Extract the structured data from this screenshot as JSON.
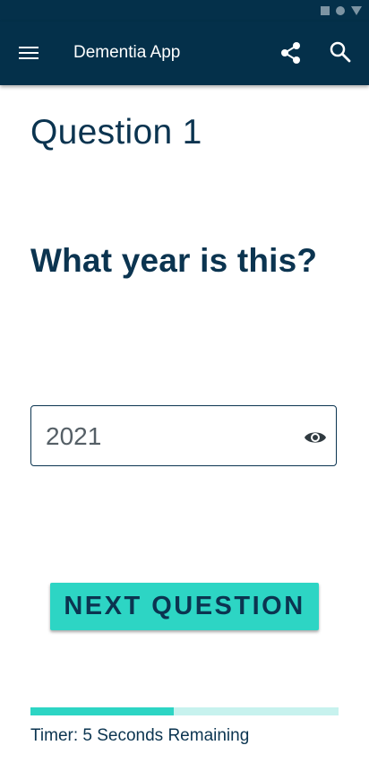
{
  "app_bar": {
    "title": "Dementia App",
    "menu_icon": "hamburger-menu-icon",
    "share_icon": "share-icon",
    "search_icon": "search-icon"
  },
  "question": {
    "number_label": "Question 1",
    "text": "What year is this?"
  },
  "answer": {
    "value": "2021",
    "visibility_icon": "eye-icon"
  },
  "next_button_label": "NEXT QUESTION",
  "timer": {
    "label": "Timer: 5 Seconds Remaining",
    "progress_fraction": 0.465
  },
  "colors": {
    "app_bar": "#04304a",
    "accent": "#2dd5c4",
    "accent_light": "#c7f2ee",
    "text_dark": "#0b3450"
  }
}
